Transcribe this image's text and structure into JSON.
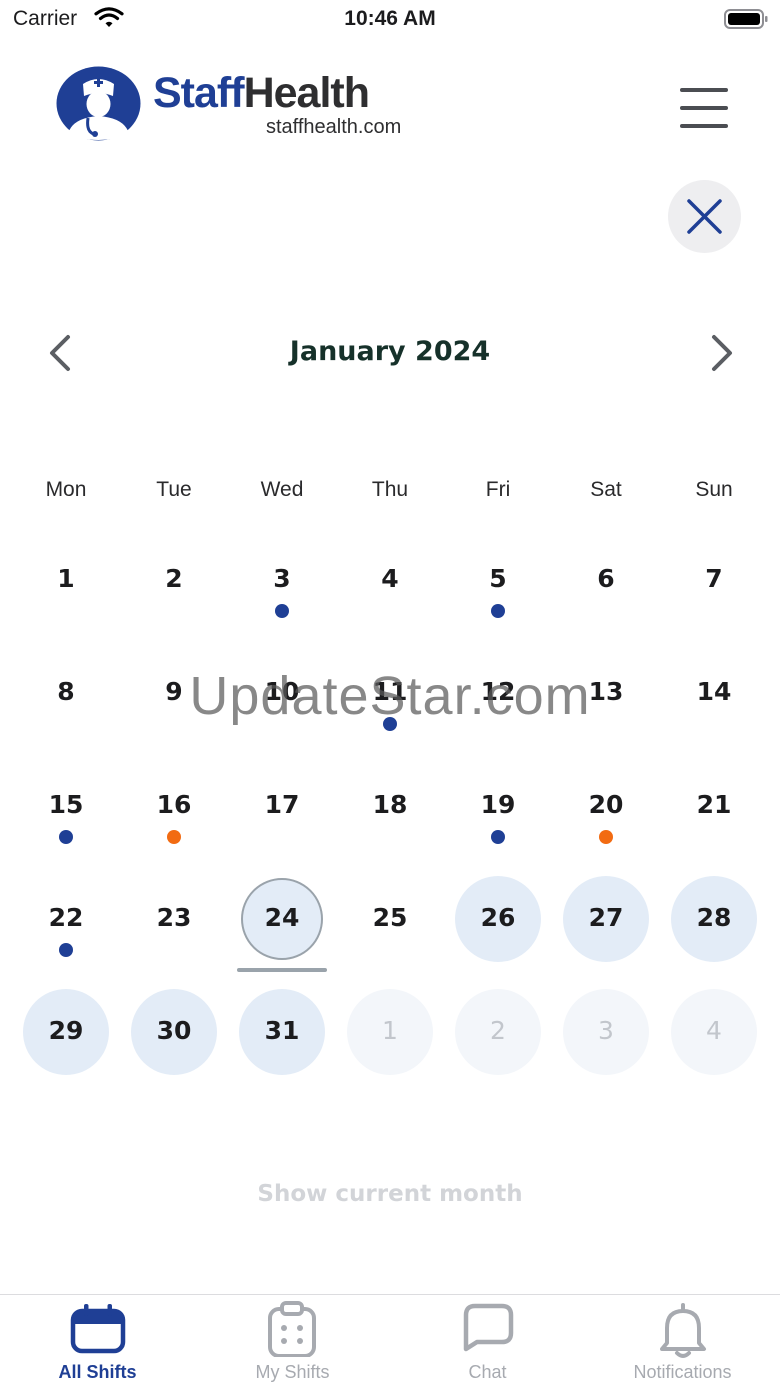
{
  "status_bar": {
    "carrier": "Carrier",
    "time": "10:46 AM"
  },
  "header": {
    "brand_part1": "Staff",
    "brand_part2": "Health",
    "brand_url": "staffhealth.com",
    "menu_icon": "hamburger-menu-icon",
    "close_icon": "close-icon"
  },
  "calendar": {
    "month_title": "January 2024",
    "prev_icon": "chevron-left-icon",
    "next_icon": "chevron-right-icon",
    "weekdays": [
      "Mon",
      "Tue",
      "Wed",
      "Thu",
      "Fri",
      "Sat",
      "Sun"
    ],
    "weeks": [
      [
        {
          "day": "1"
        },
        {
          "day": "2"
        },
        {
          "day": "3",
          "dot": "blue"
        },
        {
          "day": "4"
        },
        {
          "day": "5",
          "dot": "blue"
        },
        {
          "day": "6"
        },
        {
          "day": "7"
        }
      ],
      [
        {
          "day": "8"
        },
        {
          "day": "9"
        },
        {
          "day": "10"
        },
        {
          "day": "11",
          "dot": "blue"
        },
        {
          "day": "12"
        },
        {
          "day": "13"
        },
        {
          "day": "14"
        }
      ],
      [
        {
          "day": "15",
          "dot": "blue"
        },
        {
          "day": "16",
          "dot": "orange"
        },
        {
          "day": "17"
        },
        {
          "day": "18"
        },
        {
          "day": "19",
          "dot": "blue"
        },
        {
          "day": "20",
          "dot": "orange"
        },
        {
          "day": "21"
        }
      ],
      [
        {
          "day": "22",
          "dot": "blue"
        },
        {
          "day": "23"
        },
        {
          "day": "24",
          "state": "today"
        },
        {
          "day": "25"
        },
        {
          "day": "26",
          "state": "future"
        },
        {
          "day": "27",
          "state": "future"
        },
        {
          "day": "28",
          "state": "future"
        }
      ],
      [
        {
          "day": "29",
          "state": "future"
        },
        {
          "day": "30",
          "state": "future"
        },
        {
          "day": "31",
          "state": "future"
        },
        {
          "day": "1",
          "state": "next"
        },
        {
          "day": "2",
          "state": "next"
        },
        {
          "day": "3",
          "state": "next"
        },
        {
          "day": "4",
          "state": "next"
        }
      ]
    ],
    "show_current_month": "Show current month"
  },
  "watermark": "UpdateStar.com",
  "tabs": [
    {
      "label": "All Shifts",
      "icon": "calendar-icon",
      "active": true
    },
    {
      "label": "My Shifts",
      "icon": "clipboard-icon",
      "active": false
    },
    {
      "label": "Chat",
      "icon": "chat-bubble-icon",
      "active": false
    },
    {
      "label": "Notifications",
      "icon": "bell-icon",
      "active": false
    }
  ],
  "colors": {
    "brand_blue": "#1f3f95",
    "dot_blue": "#1f3f95",
    "dot_orange": "#f26b12",
    "future_day_bg": "#e3ecf7",
    "next_month_bg": "#f3f6fa",
    "inactive_tab": "#a7aab0"
  }
}
